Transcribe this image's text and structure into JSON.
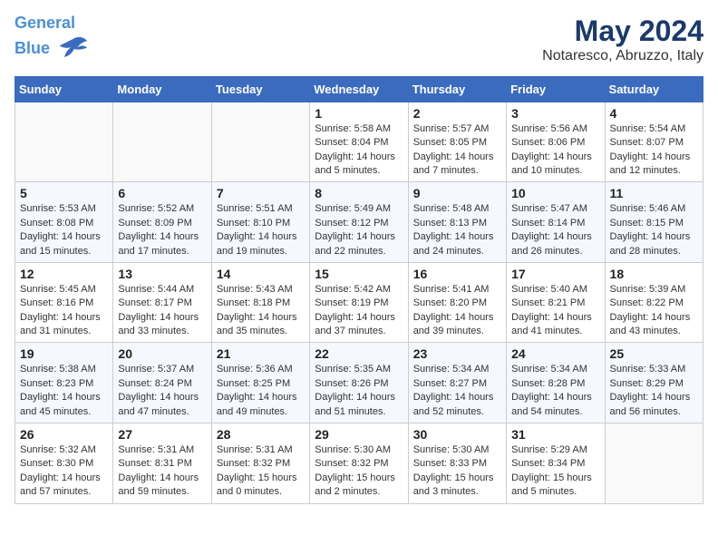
{
  "header": {
    "logo_line1": "General",
    "logo_line2": "Blue",
    "month": "May 2024",
    "location": "Notaresco, Abruzzo, Italy"
  },
  "weekdays": [
    "Sunday",
    "Monday",
    "Tuesday",
    "Wednesday",
    "Thursday",
    "Friday",
    "Saturday"
  ],
  "weeks": [
    [
      {
        "day": "",
        "info": ""
      },
      {
        "day": "",
        "info": ""
      },
      {
        "day": "",
        "info": ""
      },
      {
        "day": "1",
        "info": "Sunrise: 5:58 AM\nSunset: 8:04 PM\nDaylight: 14 hours\nand 5 minutes."
      },
      {
        "day": "2",
        "info": "Sunrise: 5:57 AM\nSunset: 8:05 PM\nDaylight: 14 hours\nand 7 minutes."
      },
      {
        "day": "3",
        "info": "Sunrise: 5:56 AM\nSunset: 8:06 PM\nDaylight: 14 hours\nand 10 minutes."
      },
      {
        "day": "4",
        "info": "Sunrise: 5:54 AM\nSunset: 8:07 PM\nDaylight: 14 hours\nand 12 minutes."
      }
    ],
    [
      {
        "day": "5",
        "info": "Sunrise: 5:53 AM\nSunset: 8:08 PM\nDaylight: 14 hours\nand 15 minutes."
      },
      {
        "day": "6",
        "info": "Sunrise: 5:52 AM\nSunset: 8:09 PM\nDaylight: 14 hours\nand 17 minutes."
      },
      {
        "day": "7",
        "info": "Sunrise: 5:51 AM\nSunset: 8:10 PM\nDaylight: 14 hours\nand 19 minutes."
      },
      {
        "day": "8",
        "info": "Sunrise: 5:49 AM\nSunset: 8:12 PM\nDaylight: 14 hours\nand 22 minutes."
      },
      {
        "day": "9",
        "info": "Sunrise: 5:48 AM\nSunset: 8:13 PM\nDaylight: 14 hours\nand 24 minutes."
      },
      {
        "day": "10",
        "info": "Sunrise: 5:47 AM\nSunset: 8:14 PM\nDaylight: 14 hours\nand 26 minutes."
      },
      {
        "day": "11",
        "info": "Sunrise: 5:46 AM\nSunset: 8:15 PM\nDaylight: 14 hours\nand 28 minutes."
      }
    ],
    [
      {
        "day": "12",
        "info": "Sunrise: 5:45 AM\nSunset: 8:16 PM\nDaylight: 14 hours\nand 31 minutes."
      },
      {
        "day": "13",
        "info": "Sunrise: 5:44 AM\nSunset: 8:17 PM\nDaylight: 14 hours\nand 33 minutes."
      },
      {
        "day": "14",
        "info": "Sunrise: 5:43 AM\nSunset: 8:18 PM\nDaylight: 14 hours\nand 35 minutes."
      },
      {
        "day": "15",
        "info": "Sunrise: 5:42 AM\nSunset: 8:19 PM\nDaylight: 14 hours\nand 37 minutes."
      },
      {
        "day": "16",
        "info": "Sunrise: 5:41 AM\nSunset: 8:20 PM\nDaylight: 14 hours\nand 39 minutes."
      },
      {
        "day": "17",
        "info": "Sunrise: 5:40 AM\nSunset: 8:21 PM\nDaylight: 14 hours\nand 41 minutes."
      },
      {
        "day": "18",
        "info": "Sunrise: 5:39 AM\nSunset: 8:22 PM\nDaylight: 14 hours\nand 43 minutes."
      }
    ],
    [
      {
        "day": "19",
        "info": "Sunrise: 5:38 AM\nSunset: 8:23 PM\nDaylight: 14 hours\nand 45 minutes."
      },
      {
        "day": "20",
        "info": "Sunrise: 5:37 AM\nSunset: 8:24 PM\nDaylight: 14 hours\nand 47 minutes."
      },
      {
        "day": "21",
        "info": "Sunrise: 5:36 AM\nSunset: 8:25 PM\nDaylight: 14 hours\nand 49 minutes."
      },
      {
        "day": "22",
        "info": "Sunrise: 5:35 AM\nSunset: 8:26 PM\nDaylight: 14 hours\nand 51 minutes."
      },
      {
        "day": "23",
        "info": "Sunrise: 5:34 AM\nSunset: 8:27 PM\nDaylight: 14 hours\nand 52 minutes."
      },
      {
        "day": "24",
        "info": "Sunrise: 5:34 AM\nSunset: 8:28 PM\nDaylight: 14 hours\nand 54 minutes."
      },
      {
        "day": "25",
        "info": "Sunrise: 5:33 AM\nSunset: 8:29 PM\nDaylight: 14 hours\nand 56 minutes."
      }
    ],
    [
      {
        "day": "26",
        "info": "Sunrise: 5:32 AM\nSunset: 8:30 PM\nDaylight: 14 hours\nand 57 minutes."
      },
      {
        "day": "27",
        "info": "Sunrise: 5:31 AM\nSunset: 8:31 PM\nDaylight: 14 hours\nand 59 minutes."
      },
      {
        "day": "28",
        "info": "Sunrise: 5:31 AM\nSunset: 8:32 PM\nDaylight: 15 hours\nand 0 minutes."
      },
      {
        "day": "29",
        "info": "Sunrise: 5:30 AM\nSunset: 8:32 PM\nDaylight: 15 hours\nand 2 minutes."
      },
      {
        "day": "30",
        "info": "Sunrise: 5:30 AM\nSunset: 8:33 PM\nDaylight: 15 hours\nand 3 minutes."
      },
      {
        "day": "31",
        "info": "Sunrise: 5:29 AM\nSunset: 8:34 PM\nDaylight: 15 hours\nand 5 minutes."
      },
      {
        "day": "",
        "info": ""
      }
    ]
  ]
}
